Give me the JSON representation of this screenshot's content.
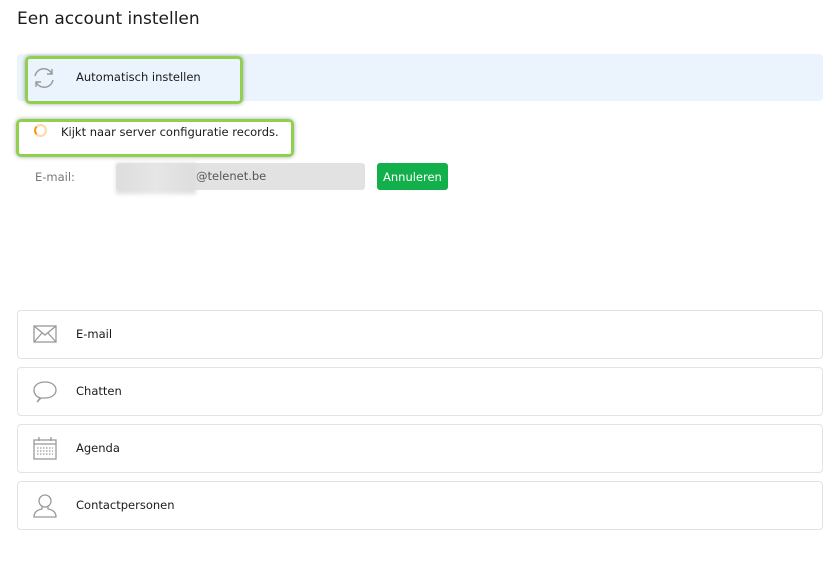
{
  "page": {
    "title": "Een account instellen"
  },
  "auto_setup": {
    "label": "Automatisch instellen"
  },
  "status": {
    "text": "Kijkt naar server configuratie records."
  },
  "email": {
    "label": "E-mail:",
    "value": "@telenet.be"
  },
  "cancel_button": {
    "label": "Annuleren"
  },
  "options": [
    {
      "label": "E-mail",
      "icon": "envelope-icon"
    },
    {
      "label": "Chatten",
      "icon": "chat-bubble-icon"
    },
    {
      "label": "Agenda",
      "icon": "calendar-icon"
    },
    {
      "label": "Contactpersonen",
      "icon": "person-icon"
    }
  ],
  "colors": {
    "accent": "#12b04a",
    "highlight": "#8fd14f",
    "auto_bg": "#ebf3fd"
  }
}
